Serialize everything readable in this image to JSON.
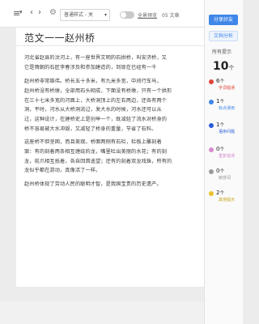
{
  "toolbar": {
    "font_style_value": "普通样式 - 关",
    "proof_mode_label": "全景预览",
    "time_label": "05 文章"
  },
  "document": {
    "title": "范文一一赵州桥",
    "paragraphs": [
      [
        "河北省赵县的汶河上，有一座世界文明的石拱桥，叫安济桥，又",
        "它是隋朝的石匠李春涉及和参加建造的，到现在已经有一千"
      ],
      [
        "赵州桥非常雄伟。桥长五十多米，有九米多宽，中间行车马，",
        "赵州桥没有桥墩，全部用石头砌成，下面没有桥墩，只有一个拱形",
        "在三十七米多宽的河面上，大桥洞顶上的左右两边，还各有两个",
        "洞，平时，河水从大桥洞流过，发大水的时候，河水还可以从",
        "过，这种设计，在建桥史上是创举一个，既减轻了流水对桥身的",
        "桥不容易被大水冲毁，又减轻了桥身的重量，节省了石料。"
      ],
      [
        "这座桥不但坚固，而且美观。桥面两侧有石栏，栏板上雕刻着",
        "案：有的刻着两条相互缠绕的龙，嘴里吐出美丽的水花；有的刻",
        "龙，前爪相互抵着，各自回首遥望；还有的刻着双龙戏珠，所有的",
        "龙似乎都在游动，真像活了一样。"
      ],
      [
        "赵州桥体现了劳动人民的聪明才智，是我国宝贵的历史遗产。"
      ]
    ]
  },
  "panel": {
    "primary_button": "分享好友",
    "secondary_button": "文档分析",
    "all_label": "所有提示",
    "total_count": "10",
    "total_unit": "个",
    "categories": [
      {
        "count": "6",
        "unit": "个",
        "name": "字词错误",
        "color": "#e0463c"
      },
      {
        "count": "1",
        "unit": "个",
        "name": "标点误用",
        "color": "#3f87e8"
      },
      {
        "count": "1",
        "unit": "个",
        "name": "语序问题",
        "color": "#2a5bd8"
      },
      {
        "count": "0",
        "unit": "个",
        "name": "重复错误",
        "color": "#d68ad0"
      },
      {
        "count": "0",
        "unit": "个",
        "name": "敏感词",
        "color": "#9a9a9a"
      },
      {
        "count": "2",
        "unit": "个",
        "name": "其他提示",
        "color": "#e8c22c"
      }
    ]
  }
}
